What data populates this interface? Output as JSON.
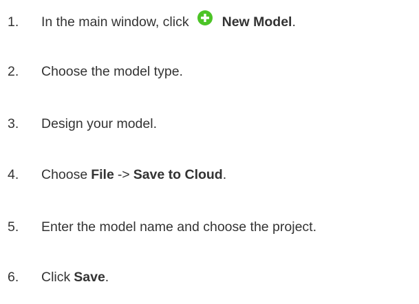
{
  "steps": [
    {
      "number": "1.",
      "text_before": "In the main window, click",
      "icon": "plus-circle-icon",
      "bold": "New Model",
      "text_after": "."
    },
    {
      "number": "2.",
      "text": "Choose the model type."
    },
    {
      "number": "3.",
      "text": "Design your model."
    },
    {
      "number": "4.",
      "text_before": "Choose",
      "bold_1": "File",
      "arrow": "->",
      "bold_2": "Save to Cloud",
      "text_after": "."
    },
    {
      "number": "5.",
      "text": "Enter the model name and choose the project."
    },
    {
      "number": "6.",
      "text_before": "Click",
      "bold": "Save",
      "text_after": "."
    }
  ],
  "colors": {
    "text": "#333333",
    "icon_fill": "#4cc427",
    "icon_glyph": "#ffffff"
  }
}
